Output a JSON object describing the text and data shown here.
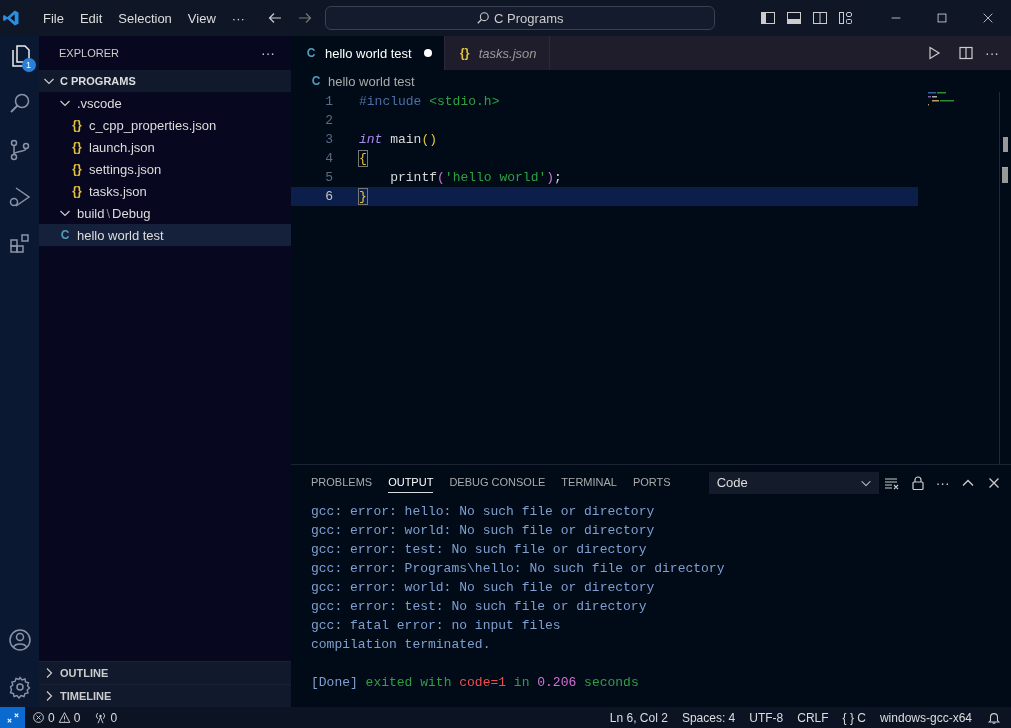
{
  "window": {
    "menu": [
      "File",
      "Edit",
      "Selection",
      "View"
    ],
    "more": "···",
    "search": "C Programs"
  },
  "activity_bar": {
    "explorer_badge": "1"
  },
  "sidebar": {
    "title": "EXPLORER",
    "more": "···",
    "section": {
      "label": "C PROGRAMS",
      "expanded": true
    },
    "tree": [
      {
        "label": ".vscode",
        "kind": "folder",
        "expanded": true,
        "selected": false,
        "children": [
          {
            "label": "c_cpp_properties.json",
            "kind": "json",
            "glyph": "{}",
            "selected": false
          },
          {
            "label": "launch.json",
            "kind": "json",
            "glyph": "{}",
            "selected": false
          },
          {
            "label": "settings.json",
            "kind": "json",
            "glyph": "{}",
            "selected": false
          },
          {
            "label": "tasks.json",
            "kind": "json",
            "glyph": "{}",
            "selected": false
          }
        ]
      },
      {
        "label": "build",
        "separator": "\\",
        "label_2": "Debug",
        "kind": "folder",
        "expanded": true,
        "selected": false
      },
      {
        "label": "hello world test",
        "kind": "c",
        "glyph": "C",
        "selected": true
      }
    ],
    "bottom_sections": [
      {
        "label": "OUTLINE",
        "expanded": false
      },
      {
        "label": "TIMELINE",
        "expanded": false
      }
    ]
  },
  "tabs": [
    {
      "label": "hello world test",
      "glyph": "C",
      "kind": "c",
      "selected": true,
      "modified": true,
      "preview": false
    },
    {
      "label": "tasks.json",
      "glyph": "{}",
      "kind": "json",
      "selected": false,
      "modified": false,
      "preview": true
    }
  ],
  "breadcrumb": {
    "glyph": "C",
    "label": "hello world test"
  },
  "code": [
    {
      "number": "1",
      "current": false,
      "tokens": [
        {
          "kind": "directive",
          "text": "#include "
        },
        {
          "kind": "header",
          "text": "<stdio.h>"
        }
      ]
    },
    {
      "number": "2",
      "current": false
    },
    {
      "number": "3",
      "current": false,
      "tokens": [
        {
          "kind": "keyword",
          "text": "int"
        },
        {
          "kind": "plain",
          "text": " main"
        },
        {
          "kind": "paren",
          "text": "()"
        }
      ]
    },
    {
      "number": "4",
      "current": false,
      "tokens": [
        {
          "kind": "brace",
          "text": "{"
        }
      ]
    },
    {
      "number": "5",
      "current": false,
      "tokens": [
        {
          "kind": "plain",
          "text": "    printf"
        },
        {
          "kind": "paren2",
          "text": "("
        },
        {
          "kind": "string",
          "text": "'hello world'"
        },
        {
          "kind": "paren2",
          "text": ")"
        },
        {
          "kind": "plain",
          "text": ";"
        }
      ]
    },
    {
      "number": "6",
      "current": true,
      "tokens": [
        {
          "kind": "brace",
          "text": "}"
        }
      ]
    }
  ],
  "panel": {
    "tabs": [
      {
        "label": "PROBLEMS",
        "selected": false
      },
      {
        "label": "OUTPUT",
        "selected": true
      },
      {
        "label": "DEBUG CONSOLE",
        "selected": false
      },
      {
        "label": "TERMINAL",
        "selected": false
      },
      {
        "label": "PORTS",
        "selected": false
      }
    ],
    "channel": "Code",
    "more": "···",
    "output": [
      {
        "kind": "text",
        "segments": [
          {
            "kind": "plain",
            "text": "gcc: error: hello: No such file or directory"
          }
        ]
      },
      {
        "kind": "text",
        "segments": [
          {
            "kind": "plain",
            "text": "gcc: error: world: No such file or directory"
          }
        ]
      },
      {
        "kind": "text",
        "segments": [
          {
            "kind": "plain",
            "text": "gcc: error: test: No such file or directory"
          }
        ]
      },
      {
        "kind": "text",
        "segments": [
          {
            "kind": "plain",
            "text": "gcc: error: Programs\\hello: No such file or directory"
          }
        ]
      },
      {
        "kind": "text",
        "segments": [
          {
            "kind": "plain",
            "text": "gcc: error: world: No such file or directory"
          }
        ]
      },
      {
        "kind": "text",
        "segments": [
          {
            "kind": "plain",
            "text": "gcc: error: test: No such file or directory"
          }
        ]
      },
      {
        "kind": "text",
        "segments": [
          {
            "kind": "plain",
            "text": "gcc: fatal error: no input files"
          }
        ]
      },
      {
        "kind": "text",
        "segments": [
          {
            "kind": "plain",
            "text": "compilation terminated."
          }
        ]
      },
      {
        "kind": "blank"
      },
      {
        "kind": "text",
        "segments": [
          {
            "kind": "plain",
            "text": "[Done]"
          },
          {
            "kind": "green",
            "text": " exited with "
          },
          {
            "kind": "red",
            "text": "code=1"
          },
          {
            "kind": "green",
            "text": " in "
          },
          {
            "kind": "pink",
            "text": "0.206"
          },
          {
            "kind": "green",
            "text": " seconds"
          }
        ]
      }
    ]
  },
  "status_bar": {
    "errors": "0",
    "warnings": "0",
    "ports": "0",
    "right": [
      "Ln 6, Col 2",
      "Spaces: 4",
      "UTF-8",
      "CRLF"
    ],
    "language_glyph": "{ }",
    "language": "C",
    "compiler": "windows-gcc-x64"
  }
}
